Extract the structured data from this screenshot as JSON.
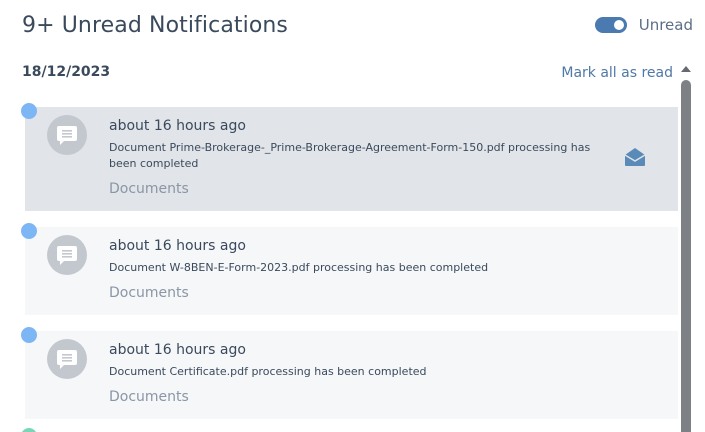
{
  "header": {
    "title": "9+ Unread Notifications",
    "toggle_label": "Unread",
    "toggle_on": true,
    "accent_color": "#4a7ab0"
  },
  "group": {
    "date": "18/12/2023",
    "mark_all_label": "Mark all as read"
  },
  "notifications": [
    {
      "time": "about 16 hours ago",
      "message": "Document Prime-Brokerage-_Prime-Brokerage-Agreement-Form-150.pdf processing has been completed",
      "category": "Documents",
      "unread": true,
      "hovered": true,
      "avatar_icon": "chat-bubble-icon",
      "action_icon": "envelope-open-icon"
    },
    {
      "time": "about 16 hours ago",
      "message": "Document W-8BEN-E-Form-2023.pdf processing has been completed",
      "category": "Documents",
      "unread": true,
      "hovered": false,
      "avatar_icon": "chat-bubble-icon"
    },
    {
      "time": "about 16 hours ago",
      "message": "Document Certificate.pdf processing has been completed",
      "category": "Documents",
      "unread": true,
      "hovered": false,
      "avatar_icon": "chat-bubble-icon"
    }
  ],
  "colors": {
    "unread_dot": "#7db6f5",
    "card_bg": "#f6f7f9",
    "card_hover_bg": "#e1e4e9",
    "link": "#4f79a6"
  }
}
